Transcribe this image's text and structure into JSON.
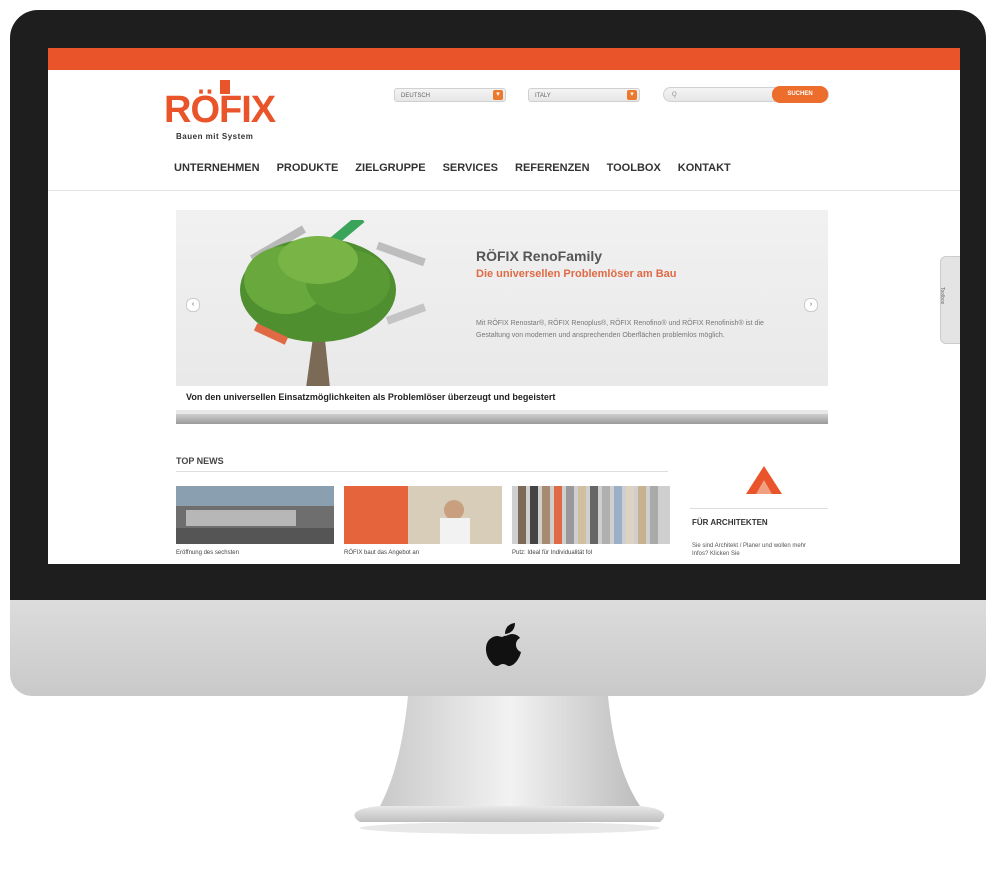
{
  "brand": {
    "logo_text": "RÖFIX",
    "tagline": "Bauen mit System",
    "accent": "#e9542a"
  },
  "header": {
    "language_select": "DEUTSCH",
    "country_select": "ITALY",
    "search_placeholder": "Q",
    "search_button": "SUCHEN"
  },
  "nav": {
    "items": [
      "UNTERNEHMEN",
      "PRODUKTE",
      "ZIELGRUPPE",
      "SERVICES",
      "REFERENZEN",
      "TOOLBOX",
      "KONTAKT"
    ]
  },
  "slider": {
    "title": "RÖFIX RenoFamily",
    "subtitle": "Die universellen Problemlöser am Bau",
    "body": "Mit RÖFIX Renostar®, RÖFIX Renoplus®, RÖFIX Renofino® und RÖFIX Renofinish® ist die Gestaltung von modernen und ansprechenden Oberflächen problemlos möglich.",
    "caption": "Von den universellen Einsatzmöglichkeiten als Problemlöser überzeugt und begeistert",
    "prev_icon": "chevron-left-icon",
    "next_icon": "chevron-right-icon"
  },
  "side_tab": {
    "label": "Toolbox"
  },
  "news": {
    "title": "TOP NEWS",
    "items": [
      {
        "caption": "Eröffnung des sechsten"
      },
      {
        "caption": "RÖFIX baut das Angebot an"
      },
      {
        "caption": "Putz: Ideal für Individualität fol"
      }
    ]
  },
  "architects": {
    "title": "FÜR ARCHITEKTEN",
    "text": "Sie sind Architekt / Planer und wollen mehr Infos? Klicken Sie"
  }
}
